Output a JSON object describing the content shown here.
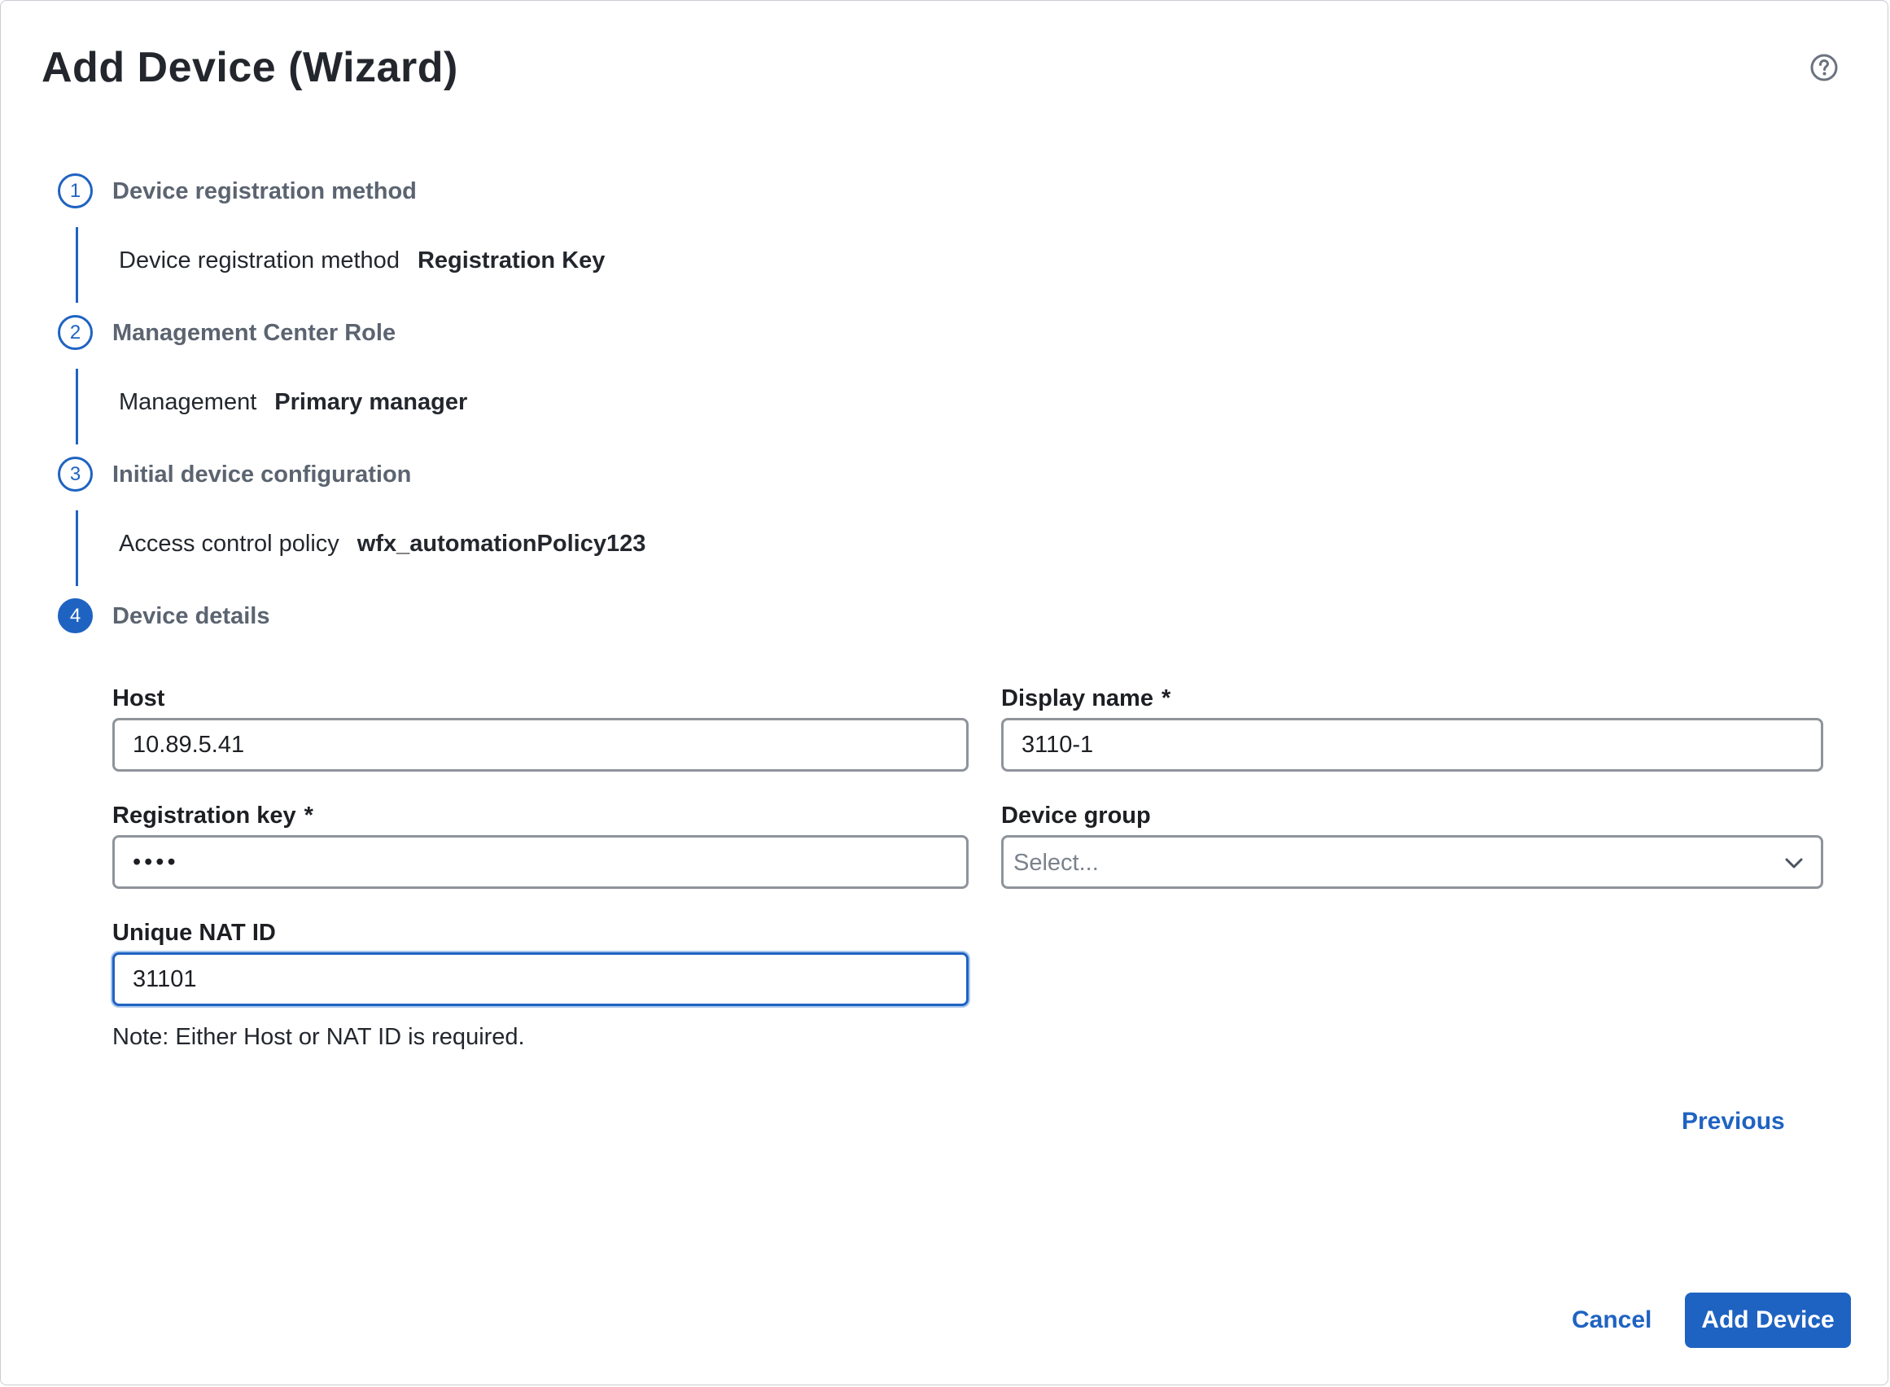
{
  "dialog": {
    "title": "Add Device (Wizard)",
    "help_icon": "help-circle-icon"
  },
  "steps": [
    {
      "number": "1",
      "title": "Device registration method",
      "summary_label": "Device registration method",
      "summary_value": "Registration Key",
      "state": "completed"
    },
    {
      "number": "2",
      "title": "Management Center Role",
      "summary_label": "Management",
      "summary_value": "Primary manager",
      "state": "completed"
    },
    {
      "number": "3",
      "title": "Initial device configuration",
      "summary_label": "Access control policy",
      "summary_value": "wfx_automationPolicy123",
      "state": "completed"
    },
    {
      "number": "4",
      "title": "Device details",
      "state": "active"
    }
  ],
  "form": {
    "host": {
      "label": "Host",
      "value": "10.89.5.41"
    },
    "display_name": {
      "label": "Display name",
      "required_mark": "*",
      "value": "3110-1"
    },
    "registration_key": {
      "label": "Registration key",
      "required_mark": "*",
      "value": "••••"
    },
    "device_group": {
      "label": "Device group",
      "placeholder": "Select..."
    },
    "nat_id": {
      "label": "Unique NAT ID",
      "value": "31101"
    },
    "note": "Note: Either Host or NAT ID is required."
  },
  "buttons": {
    "previous": "Previous",
    "cancel": "Cancel",
    "add_device": "Add Device"
  },
  "colors": {
    "accent": "#1f63c2",
    "step_title": "#5b6470",
    "input_border": "#8f949b"
  }
}
